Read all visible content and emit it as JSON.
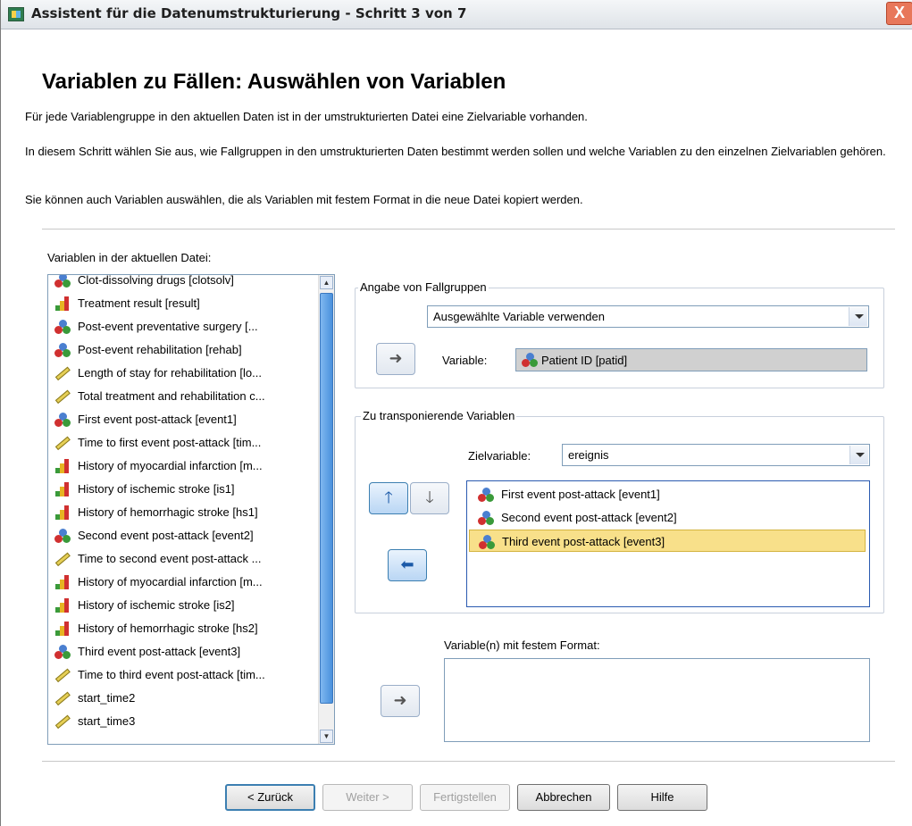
{
  "window": {
    "title": "Assistent für die Datenumstrukturierung - Schritt 3 von 7",
    "close_label": "X"
  },
  "header": {
    "heading": "Variablen zu Fällen: Auswählen von Variablen",
    "desc1": "Für jede Variablengruppe in den aktuellen Daten ist in der umstrukturierten Datei eine Zielvariable vorhanden.",
    "desc2": "In diesem Schritt wählen Sie aus, wie Fallgruppen in den umstrukturierten Daten bestimmt werden sollen und welche Variablen zu den einzelnen Zielvariablen gehören.",
    "desc3": "Sie können auch Variablen auswählen, die als Variablen mit festem Format in die neue Datei kopiert werden."
  },
  "source_list": {
    "label": "Variablen in der aktuellen Datei:",
    "items": [
      {
        "label": "Clot-dissolving drugs [clotsolv]",
        "icon": "nominal-icon"
      },
      {
        "label": "Treatment result [result]",
        "icon": "ordinal-icon"
      },
      {
        "label": "Post-event preventative surgery [...",
        "icon": "nominal-icon"
      },
      {
        "label": "Post-event rehabilitation [rehab]",
        "icon": "nominal-icon"
      },
      {
        "label": "Length of stay for rehabilitation [lo...",
        "icon": "scale-icon"
      },
      {
        "label": "Total treatment and rehabilitation c...",
        "icon": "scale-icon"
      },
      {
        "label": "First event post-attack [event1]",
        "icon": "nominal-icon"
      },
      {
        "label": "Time to first event post-attack [tim...",
        "icon": "scale-icon"
      },
      {
        "label": "History of myocardial infarction [m...",
        "icon": "ordinal-icon"
      },
      {
        "label": "History of ischemic stroke [is1]",
        "icon": "ordinal-icon"
      },
      {
        "label": "History of hemorrhagic stroke [hs1]",
        "icon": "ordinal-icon"
      },
      {
        "label": "Second event post-attack [event2]",
        "icon": "nominal-icon"
      },
      {
        "label": "Time to second event post-attack ...",
        "icon": "scale-icon"
      },
      {
        "label": "History of myocardial infarction [m...",
        "icon": "ordinal-icon"
      },
      {
        "label": "History of ischemic stroke [is2]",
        "icon": "ordinal-icon"
      },
      {
        "label": "History of hemorrhagic stroke [hs2]",
        "icon": "ordinal-icon"
      },
      {
        "label": "Third event post-attack [event3]",
        "icon": "nominal-icon"
      },
      {
        "label": "Time to third event post-attack [tim...",
        "icon": "scale-icon"
      },
      {
        "label": "start_time2",
        "icon": "scale-icon"
      },
      {
        "label": "start_time3",
        "icon": "scale-icon"
      }
    ]
  },
  "case_groups": {
    "title": "Angabe von Fallgruppen",
    "mode_value": "Ausgewählte Variable verwenden",
    "variable_label": "Variable:",
    "variable_value": "Patient ID [patid]"
  },
  "transpose": {
    "title": "Zu transponierende Variablen",
    "target_label": "Zielvariable:",
    "target_value": "ereignis",
    "items": [
      {
        "label": "First event post-attack [event1]",
        "selected": false
      },
      {
        "label": "Second event post-attack [event2]",
        "selected": false
      },
      {
        "label": "Third event post-attack [event3]",
        "selected": true
      }
    ]
  },
  "fixed": {
    "label": "Variable(n) mit festem Format:"
  },
  "buttons": {
    "back": "< Zurück",
    "next": "Weiter >",
    "finish": "Fertigstellen",
    "cancel": "Abbrechen",
    "help": "Hilfe"
  },
  "arrows": {
    "right": "➜",
    "up": "🡑",
    "down": "🡓",
    "left": "⬅"
  }
}
